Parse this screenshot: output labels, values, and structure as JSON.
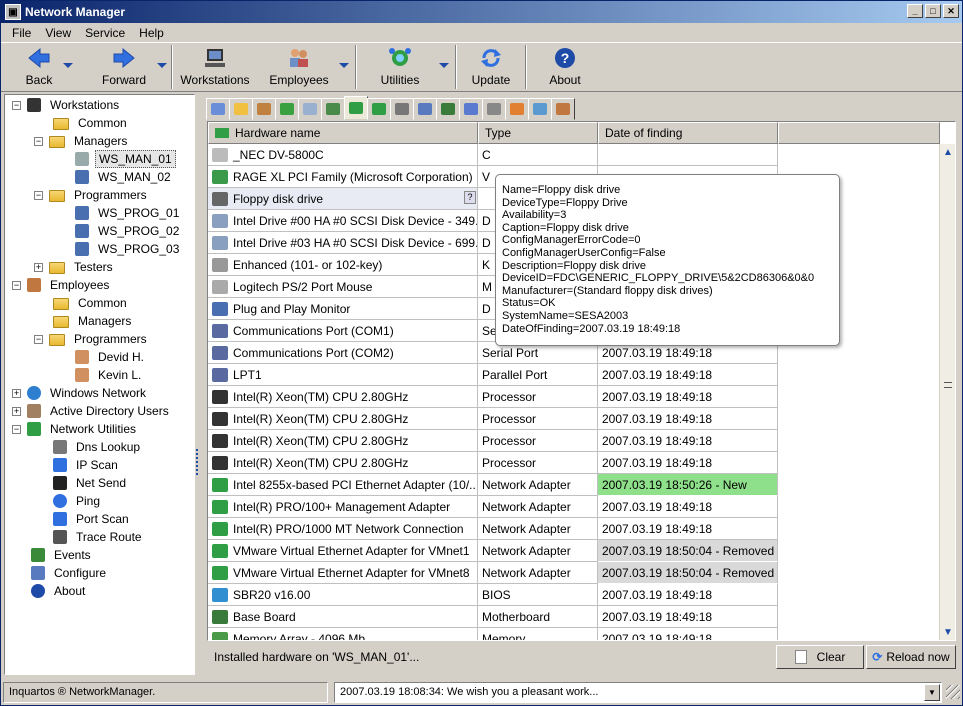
{
  "window": {
    "title": "Network Manager"
  },
  "menu": [
    "File",
    "View",
    "Service",
    "Help"
  ],
  "toolbar": {
    "back": "Back",
    "forward": "Forward",
    "workstations": "Workstations",
    "employees": "Employees",
    "utilities": "Utilities",
    "update": "Update",
    "about": "About"
  },
  "tree": [
    {
      "label": "Workstations",
      "level": 0,
      "exp": "−",
      "icon": "computer-icon"
    },
    {
      "label": "Common",
      "level": 1,
      "icon": "folder-icon"
    },
    {
      "label": "Managers",
      "level": 1,
      "exp": "−",
      "icon": "folder-icon"
    },
    {
      "label": "WS_MAN_01",
      "level": 2,
      "icon": "server-icon",
      "selected": true
    },
    {
      "label": "WS_MAN_02",
      "level": 2,
      "icon": "monitor-icon"
    },
    {
      "label": "Programmers",
      "level": 1,
      "exp": "−",
      "icon": "folder-icon"
    },
    {
      "label": "WS_PROG_01",
      "level": 2,
      "icon": "monitor-icon"
    },
    {
      "label": "WS_PROG_02",
      "level": 2,
      "icon": "monitor-icon"
    },
    {
      "label": "WS_PROG_03",
      "level": 2,
      "icon": "monitor-icon"
    },
    {
      "label": "Testers",
      "level": 1,
      "exp": "+",
      "icon": "folder-icon"
    },
    {
      "label": "Employees",
      "level": 0,
      "exp": "−",
      "icon": "people-icon"
    },
    {
      "label": "Common",
      "level": 1,
      "icon": "folder-icon"
    },
    {
      "label": "Managers",
      "level": 1,
      "icon": "folder-icon"
    },
    {
      "label": "Programmers",
      "level": 1,
      "exp": "−",
      "icon": "folder-icon"
    },
    {
      "label": "Devid H.",
      "level": 2,
      "icon": "person-icon"
    },
    {
      "label": "Kevin L.",
      "level": 2,
      "icon": "person-icon"
    },
    {
      "label": "Windows Network",
      "level": 0,
      "exp": "+",
      "icon": "globe-icon"
    },
    {
      "label": "Active Directory Users",
      "level": 0,
      "exp": "+",
      "icon": "book-icon"
    },
    {
      "label": "Network Utilities",
      "level": 0,
      "exp": "−",
      "icon": "network-icon"
    },
    {
      "label": "Dns Lookup",
      "level": 1,
      "icon": "dns-icon"
    },
    {
      "label": "IP Scan",
      "level": 1,
      "icon": "scan-icon"
    },
    {
      "label": "Net Send",
      "level": 1,
      "icon": "terminal-icon"
    },
    {
      "label": "Ping",
      "level": 1,
      "icon": "ping-icon"
    },
    {
      "label": "Port Scan",
      "level": 1,
      "icon": "scan-icon"
    },
    {
      "label": "Trace Route",
      "level": 1,
      "icon": "magnifier-icon"
    },
    {
      "label": "Events",
      "level": 0,
      "icon": "events-icon"
    },
    {
      "label": "Configure",
      "level": 0,
      "icon": "configure-icon"
    },
    {
      "label": "About",
      "level": 0,
      "icon": "help-icon"
    }
  ],
  "grid": {
    "headers": [
      "Hardware name",
      "Type",
      "Date of finding"
    ],
    "rows": [
      {
        "name": "_NEC DV-5800C",
        "type": "C",
        "date": "",
        "icon": "cdrom-icon"
      },
      {
        "name": "RAGE XL PCI Family (Microsoft Corporation)",
        "type": "V",
        "date": "",
        "icon": "video-card-icon"
      },
      {
        "name": "Floppy disk drive",
        "type": "",
        "date": "",
        "icon": "floppy-icon",
        "highlight": true
      },
      {
        "name": "Intel Drive #00  HA #0 SCSI Disk Device - 349...",
        "type": "D",
        "date": "",
        "icon": "disk-icon"
      },
      {
        "name": "Intel Drive #03  HA #0 SCSI Disk Device - 699...",
        "type": "D",
        "date": "",
        "icon": "disk-icon"
      },
      {
        "name": "Enhanced (101- or 102-key)",
        "type": "K",
        "date": "",
        "icon": "keyboard-icon"
      },
      {
        "name": "Logitech PS/2 Port Mouse",
        "type": "M",
        "date": "",
        "icon": "mouse-icon"
      },
      {
        "name": "Plug and Play Monitor",
        "type": "D",
        "date": "",
        "icon": "monitor-icon"
      },
      {
        "name": "Communications Port (COM1)",
        "type": "Serial Port",
        "date": "2007.03.19 18:49:18",
        "icon": "port-icon"
      },
      {
        "name": "Communications Port (COM2)",
        "type": "Serial Port",
        "date": "2007.03.19 18:49:18",
        "icon": "port-icon"
      },
      {
        "name": "LPT1",
        "type": "Parallel Port",
        "date": "2007.03.19 18:49:18",
        "icon": "port-icon"
      },
      {
        "name": "Intel(R) Xeon(TM) CPU 2.80GHz",
        "type": "Processor",
        "date": "2007.03.19 18:49:18",
        "icon": "cpu-icon"
      },
      {
        "name": "Intel(R) Xeon(TM) CPU 2.80GHz",
        "type": "Processor",
        "date": "2007.03.19 18:49:18",
        "icon": "cpu-icon"
      },
      {
        "name": "Intel(R) Xeon(TM) CPU 2.80GHz",
        "type": "Processor",
        "date": "2007.03.19 18:49:18",
        "icon": "cpu-icon"
      },
      {
        "name": "Intel(R) Xeon(TM) CPU 2.80GHz",
        "type": "Processor",
        "date": "2007.03.19 18:49:18",
        "icon": "cpu-icon"
      },
      {
        "name": "Intel 8255x-based PCI Ethernet Adapter (10/...",
        "type": "Network Adapter",
        "date": "2007.03.19 18:50:26 - New",
        "icon": "network-card-icon",
        "status": "new"
      },
      {
        "name": "Intel(R) PRO/100+ Management Adapter",
        "type": "Network Adapter",
        "date": "2007.03.19 18:49:18",
        "icon": "network-card-icon"
      },
      {
        "name": "Intel(R) PRO/1000 MT Network Connection",
        "type": "Network Adapter",
        "date": "2007.03.19 18:49:18",
        "icon": "network-card-icon"
      },
      {
        "name": "VMware Virtual Ethernet Adapter for VMnet1",
        "type": "Network Adapter",
        "date": "2007.03.19 18:50:04 - Removed",
        "icon": "network-card-icon",
        "status": "removed"
      },
      {
        "name": "VMware Virtual Ethernet Adapter for VMnet8",
        "type": "Network Adapter",
        "date": "2007.03.19 18:50:04 - Removed",
        "icon": "network-card-icon",
        "status": "removed"
      },
      {
        "name": "SBR20 v16.00",
        "type": "BIOS",
        "date": "2007.03.19 18:49:18",
        "icon": "bios-icon"
      },
      {
        "name": "Base Board",
        "type": "Motherboard",
        "date": "2007.03.19 18:49:18",
        "icon": "motherboard-icon"
      },
      {
        "name": "Memory Array - 4096 Mb",
        "type": "Memory",
        "date": "2007.03.19 18:49:18",
        "icon": "memory-icon"
      }
    ]
  },
  "tooltip": {
    "help_glyph": "?",
    "lines": [
      "Name=Floppy disk drive",
      "DeviceType=Floppy Drive",
      "Availability=3",
      "Caption=Floppy disk drive",
      "ConfigManagerErrorCode=0",
      "ConfigManagerUserConfig=False",
      "Description=Floppy disk drive",
      "DeviceID=FDC\\GENERIC_FLOPPY_DRIVE\\5&2CD86306&0&0",
      "Manufacturer=(Standard floppy disk drives)",
      "Status=OK",
      "SystemName=SESA2003",
      "DateOfFinding=2007.03.19 18:49:18"
    ]
  },
  "bottom": {
    "status": "Installed hardware on 'WS_MAN_01'...",
    "clear": "Clear",
    "reload": "Reload now"
  },
  "statusbar": {
    "left": "Inquartos ® NetworkManager.",
    "message": "2007.03.19 18:08:34: We wish you a pleasant work..."
  },
  "colors": {
    "new": "#8fe08a",
    "removed": "#d9d9d9",
    "accent": "#1e4aa8"
  }
}
